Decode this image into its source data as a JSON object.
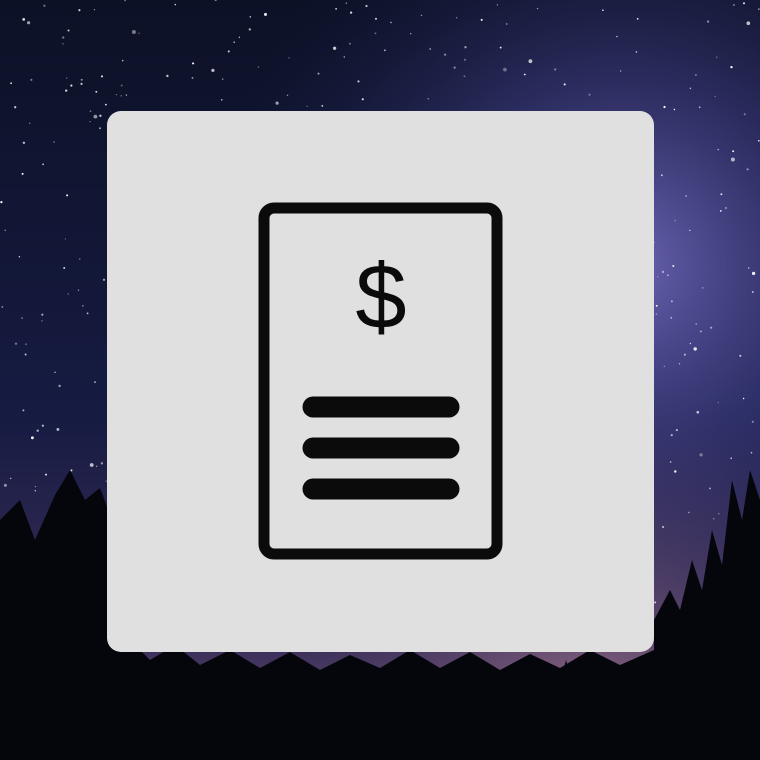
{
  "scene": {
    "background": {
      "description_colors": {
        "sky_top": "#0d1228",
        "sky_mid": "#1a1f4a",
        "milky_way": "#6b65b8",
        "horizon_glow": "#8b6a8a",
        "tree_silhouette": "#05060c"
      }
    },
    "card": {
      "background_color": "#e0e0e0",
      "icon": {
        "name": "invoice-document-icon",
        "stroke_color": "#0b0b0b",
        "currency_symbol": "$",
        "line_count": 3
      }
    }
  }
}
